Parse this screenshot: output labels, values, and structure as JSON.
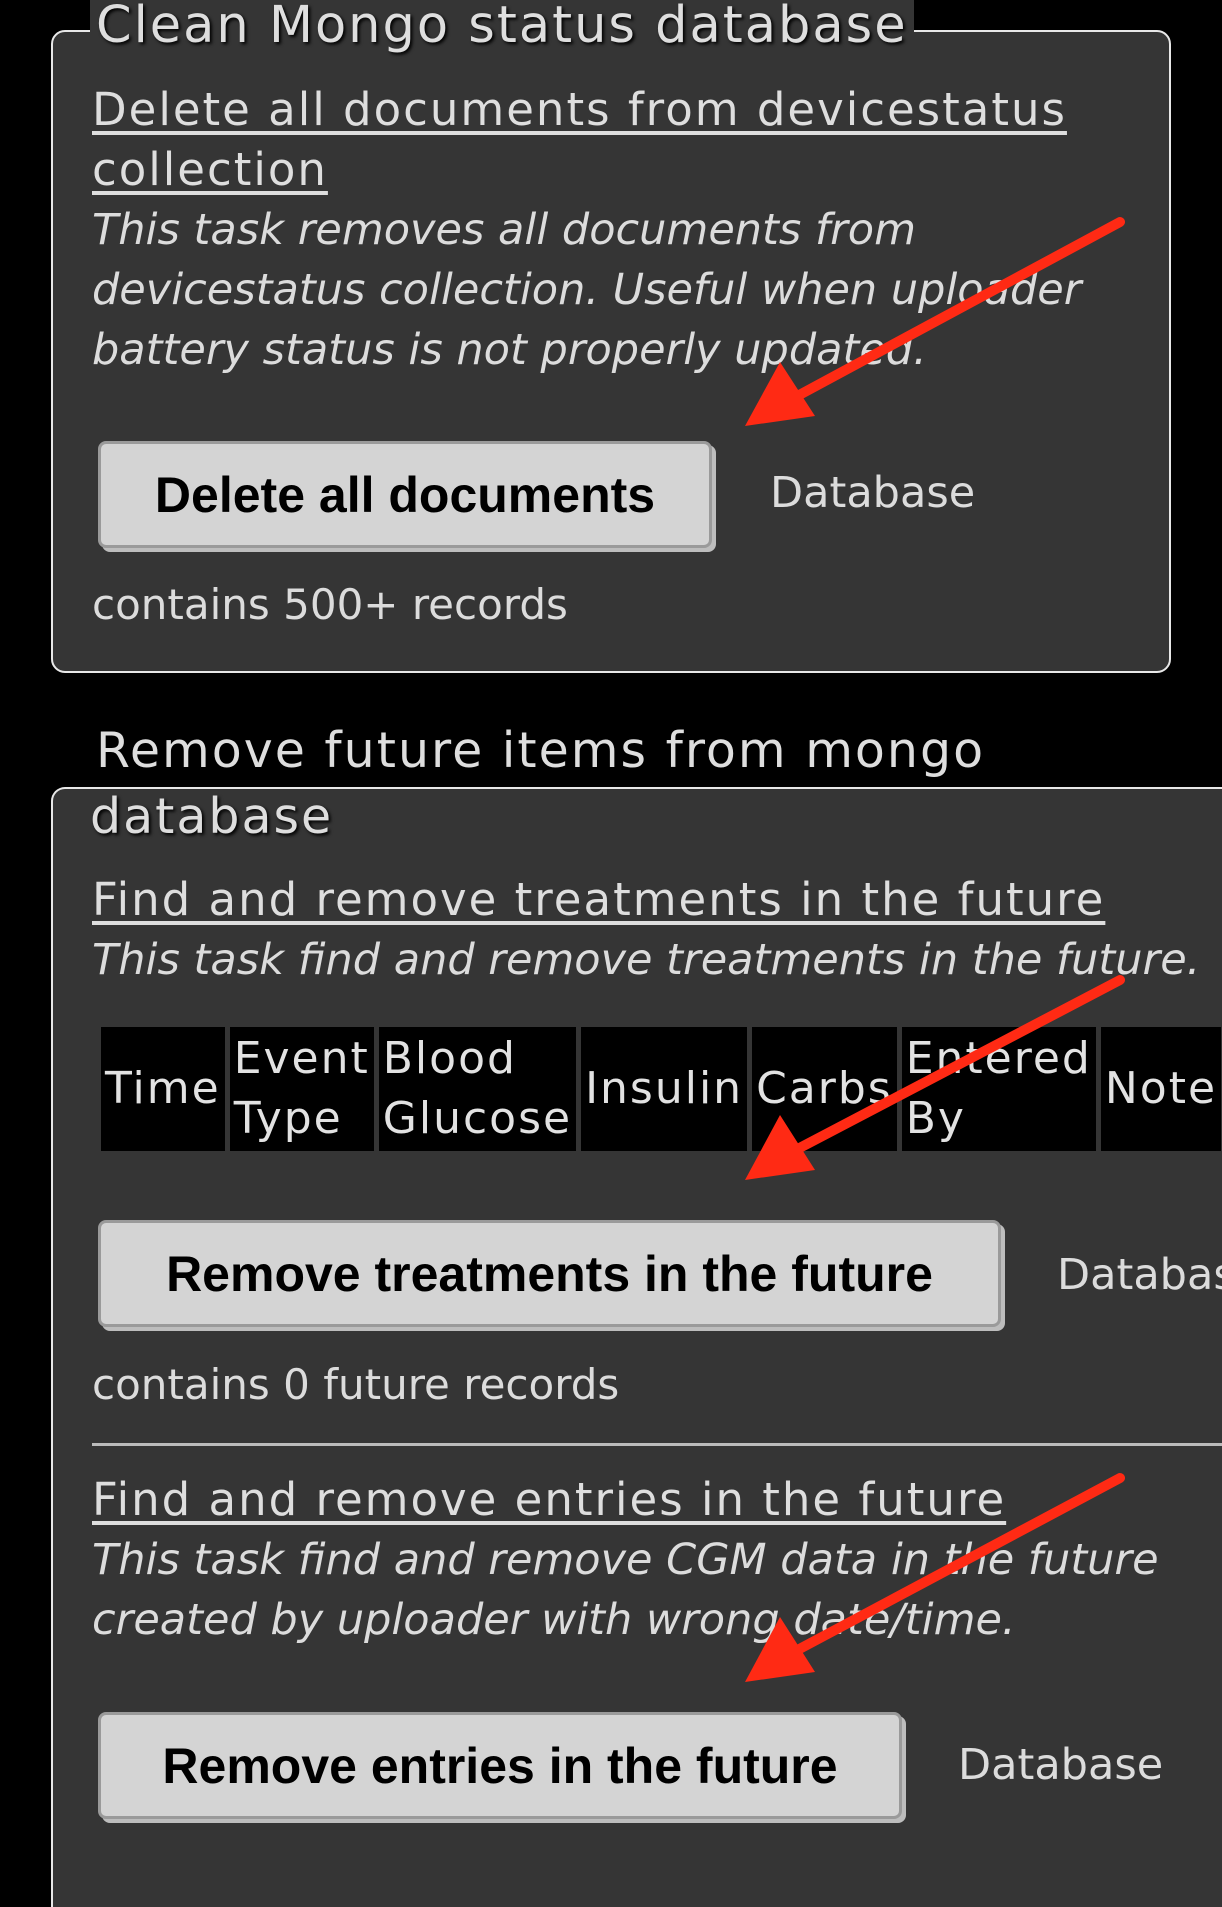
{
  "section1": {
    "legend": "Clean Mongo status database",
    "task_link": "Delete all documents from devicestatus collection",
    "description": "This task removes all documents from devicestatus collection. Useful when uploader battery status is not properly updated.",
    "button_label": "Delete all documents",
    "status_label": "Database",
    "status_count": "contains 500+ records"
  },
  "section2": {
    "legend_line1": "Remove future items from mongo",
    "legend_line2": "database",
    "task1": {
      "link": "Find and remove treatments in the future",
      "description": "This task find and remove treatments in the future.",
      "table_headers": [
        "Time",
        "Event Type",
        "Blood Glucose",
        "Insulin",
        "Carbs",
        "Entered By",
        "Note"
      ],
      "button_label": "Remove treatments in the future",
      "status_label": "Databas",
      "status_count": "contains 0 future records"
    },
    "task2": {
      "link": "Find and remove entries in the future",
      "description": "This task find and remove CGM data in the future created by uploader with wrong date/time.",
      "button_label": "Remove entries in the future",
      "status_label": "Database"
    }
  },
  "annotations": {
    "arrow_color": "#ff2a14"
  }
}
